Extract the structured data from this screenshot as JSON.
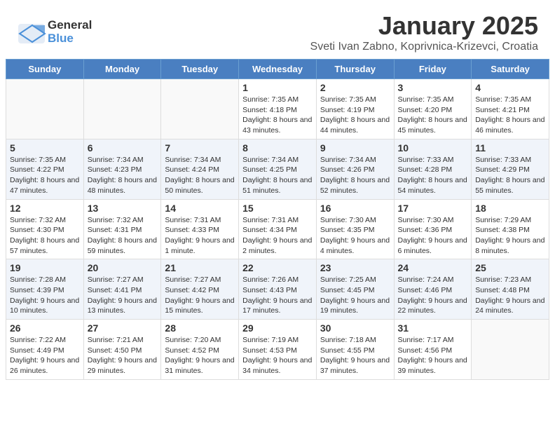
{
  "header": {
    "logo_general": "General",
    "logo_blue": "Blue",
    "main_title": "January 2025",
    "subtitle": "Sveti Ivan Zabno, Koprivnica-Krizevci, Croatia"
  },
  "weekdays": [
    "Sunday",
    "Monday",
    "Tuesday",
    "Wednesday",
    "Thursday",
    "Friday",
    "Saturday"
  ],
  "weeks": [
    [
      {
        "day": "",
        "info": ""
      },
      {
        "day": "",
        "info": ""
      },
      {
        "day": "",
        "info": ""
      },
      {
        "day": "1",
        "info": "Sunrise: 7:35 AM\nSunset: 4:18 PM\nDaylight: 8 hours and 43 minutes."
      },
      {
        "day": "2",
        "info": "Sunrise: 7:35 AM\nSunset: 4:19 PM\nDaylight: 8 hours and 44 minutes."
      },
      {
        "day": "3",
        "info": "Sunrise: 7:35 AM\nSunset: 4:20 PM\nDaylight: 8 hours and 45 minutes."
      },
      {
        "day": "4",
        "info": "Sunrise: 7:35 AM\nSunset: 4:21 PM\nDaylight: 8 hours and 46 minutes."
      }
    ],
    [
      {
        "day": "5",
        "info": "Sunrise: 7:35 AM\nSunset: 4:22 PM\nDaylight: 8 hours and 47 minutes."
      },
      {
        "day": "6",
        "info": "Sunrise: 7:34 AM\nSunset: 4:23 PM\nDaylight: 8 hours and 48 minutes."
      },
      {
        "day": "7",
        "info": "Sunrise: 7:34 AM\nSunset: 4:24 PM\nDaylight: 8 hours and 50 minutes."
      },
      {
        "day": "8",
        "info": "Sunrise: 7:34 AM\nSunset: 4:25 PM\nDaylight: 8 hours and 51 minutes."
      },
      {
        "day": "9",
        "info": "Sunrise: 7:34 AM\nSunset: 4:26 PM\nDaylight: 8 hours and 52 minutes."
      },
      {
        "day": "10",
        "info": "Sunrise: 7:33 AM\nSunset: 4:28 PM\nDaylight: 8 hours and 54 minutes."
      },
      {
        "day": "11",
        "info": "Sunrise: 7:33 AM\nSunset: 4:29 PM\nDaylight: 8 hours and 55 minutes."
      }
    ],
    [
      {
        "day": "12",
        "info": "Sunrise: 7:32 AM\nSunset: 4:30 PM\nDaylight: 8 hours and 57 minutes."
      },
      {
        "day": "13",
        "info": "Sunrise: 7:32 AM\nSunset: 4:31 PM\nDaylight: 8 hours and 59 minutes."
      },
      {
        "day": "14",
        "info": "Sunrise: 7:31 AM\nSunset: 4:33 PM\nDaylight: 9 hours and 1 minute."
      },
      {
        "day": "15",
        "info": "Sunrise: 7:31 AM\nSunset: 4:34 PM\nDaylight: 9 hours and 2 minutes."
      },
      {
        "day": "16",
        "info": "Sunrise: 7:30 AM\nSunset: 4:35 PM\nDaylight: 9 hours and 4 minutes."
      },
      {
        "day": "17",
        "info": "Sunrise: 7:30 AM\nSunset: 4:36 PM\nDaylight: 9 hours and 6 minutes."
      },
      {
        "day": "18",
        "info": "Sunrise: 7:29 AM\nSunset: 4:38 PM\nDaylight: 9 hours and 8 minutes."
      }
    ],
    [
      {
        "day": "19",
        "info": "Sunrise: 7:28 AM\nSunset: 4:39 PM\nDaylight: 9 hours and 10 minutes."
      },
      {
        "day": "20",
        "info": "Sunrise: 7:27 AM\nSunset: 4:41 PM\nDaylight: 9 hours and 13 minutes."
      },
      {
        "day": "21",
        "info": "Sunrise: 7:27 AM\nSunset: 4:42 PM\nDaylight: 9 hours and 15 minutes."
      },
      {
        "day": "22",
        "info": "Sunrise: 7:26 AM\nSunset: 4:43 PM\nDaylight: 9 hours and 17 minutes."
      },
      {
        "day": "23",
        "info": "Sunrise: 7:25 AM\nSunset: 4:45 PM\nDaylight: 9 hours and 19 minutes."
      },
      {
        "day": "24",
        "info": "Sunrise: 7:24 AM\nSunset: 4:46 PM\nDaylight: 9 hours and 22 minutes."
      },
      {
        "day": "25",
        "info": "Sunrise: 7:23 AM\nSunset: 4:48 PM\nDaylight: 9 hours and 24 minutes."
      }
    ],
    [
      {
        "day": "26",
        "info": "Sunrise: 7:22 AM\nSunset: 4:49 PM\nDaylight: 9 hours and 26 minutes."
      },
      {
        "day": "27",
        "info": "Sunrise: 7:21 AM\nSunset: 4:50 PM\nDaylight: 9 hours and 29 minutes."
      },
      {
        "day": "28",
        "info": "Sunrise: 7:20 AM\nSunset: 4:52 PM\nDaylight: 9 hours and 31 minutes."
      },
      {
        "day": "29",
        "info": "Sunrise: 7:19 AM\nSunset: 4:53 PM\nDaylight: 9 hours and 34 minutes."
      },
      {
        "day": "30",
        "info": "Sunrise: 7:18 AM\nSunset: 4:55 PM\nDaylight: 9 hours and 37 minutes."
      },
      {
        "day": "31",
        "info": "Sunrise: 7:17 AM\nSunset: 4:56 PM\nDaylight: 9 hours and 39 minutes."
      },
      {
        "day": "",
        "info": ""
      }
    ]
  ]
}
